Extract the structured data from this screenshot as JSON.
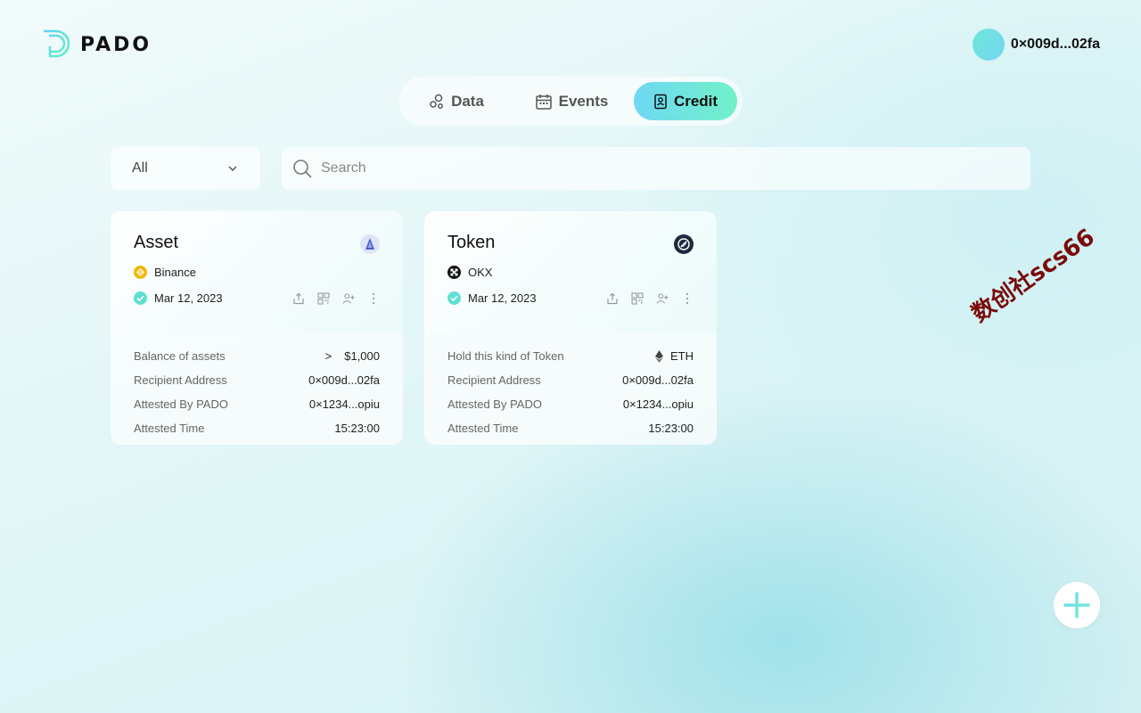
{
  "brand": {
    "name": "PADO"
  },
  "account": {
    "address": "0×009d...02fa"
  },
  "tabs": [
    {
      "label": "Data",
      "icon": "data-icon",
      "active": false
    },
    {
      "label": "Events",
      "icon": "calendar-icon",
      "active": false
    },
    {
      "label": "Credit",
      "icon": "id-badge-icon",
      "active": true
    }
  ],
  "filter": {
    "selected": "All"
  },
  "search": {
    "placeholder": "Search",
    "value": ""
  },
  "cards": [
    {
      "title": "Asset",
      "badge_icon": "triangle-badge-icon",
      "source": "Binance",
      "source_icon": "binance-icon",
      "date": "Mar 12, 2023",
      "rows": [
        {
          "label": "Balance of assets",
          "prefix": ">",
          "value": "$1,000"
        },
        {
          "label": "Recipient Address",
          "value": "0×009d...02fa"
        },
        {
          "label": "Attested By PADO",
          "value": "0×1234...opiu"
        },
        {
          "label": "Attested Time",
          "value": "15:23:00"
        }
      ]
    },
    {
      "title": "Token",
      "badge_icon": "token-badge-icon",
      "source": "OKX",
      "source_icon": "okx-icon",
      "date": "Mar 12, 2023",
      "rows": [
        {
          "label": "Hold this kind of Token",
          "value": "ETH",
          "value_icon": "eth-icon"
        },
        {
          "label": "Recipient Address",
          "value": "0×009d...02fa"
        },
        {
          "label": "Attested By PADO",
          "value": "0×1234...opiu"
        },
        {
          "label": "Attested Time",
          "value": "15:23:00"
        }
      ]
    }
  ],
  "watermark": "数创社scs66",
  "colors": {
    "accent_start": "#6fd8f3",
    "accent_end": "#70f1c8",
    "check": "#5ee0d2",
    "watermark": "#7b0a0a"
  }
}
